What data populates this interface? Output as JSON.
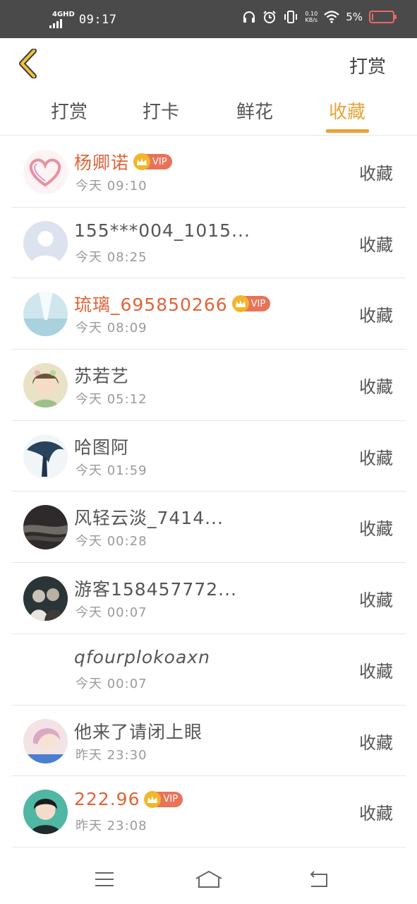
{
  "status_bar": {
    "network": "4GHD",
    "time": "09:17",
    "speed_value": "0.10",
    "speed_unit": "KB/s",
    "battery_percent": "5%",
    "battery_level": 0.05,
    "icons": [
      "headphones-icon",
      "alarm-icon",
      "vibrate-icon",
      "wifi-icon",
      "battery-icon"
    ]
  },
  "navbar": {
    "back_icon": "chevron-left-icon",
    "action_label": "打赏",
    "accent_color": "#e8a33a"
  },
  "tabs": [
    {
      "label": "打赏",
      "active": false
    },
    {
      "label": "打卡",
      "active": false
    },
    {
      "label": "鲜花",
      "active": false
    },
    {
      "label": "收藏",
      "active": true
    }
  ],
  "colors": {
    "vip_name": "#e0643a",
    "vip_badge": "#e87359",
    "accent": "#e8a33a"
  },
  "list": {
    "items": [
      {
        "name": "杨卿诺",
        "vip": true,
        "vip_label": "VIP",
        "time": "今天 09:10",
        "action": "收藏"
      },
      {
        "name": "155***004_1015...",
        "vip": false,
        "time": "今天 08:25",
        "action": "收藏"
      },
      {
        "name": "琉璃_695850266",
        "vip": true,
        "vip_label": "VIP",
        "time": "今天 08:09",
        "action": "收藏"
      },
      {
        "name": "苏若艺",
        "vip": false,
        "time": "今天 05:12",
        "action": "收藏"
      },
      {
        "name": "哈图阿",
        "vip": false,
        "time": "今天 01:59",
        "action": "收藏"
      },
      {
        "name": "风轻云淡_7414...",
        "vip": false,
        "time": "今天 00:28",
        "action": "收藏"
      },
      {
        "name": "游客158457772...",
        "vip": false,
        "time": "今天 00:07",
        "action": "收藏"
      },
      {
        "name": "qfourplokoaxn",
        "vip": false,
        "time": "今天 00:07",
        "action": "收藏"
      },
      {
        "name": "他来了请闭上眼",
        "vip": false,
        "time": "昨天 23:30",
        "action": "收藏"
      },
      {
        "name": "222.96",
        "vip": true,
        "vip_label": "VIP",
        "time": "昨天 23:08",
        "action": "收藏"
      }
    ]
  },
  "system_nav": [
    "menu-icon",
    "home-icon",
    "back-icon"
  ]
}
